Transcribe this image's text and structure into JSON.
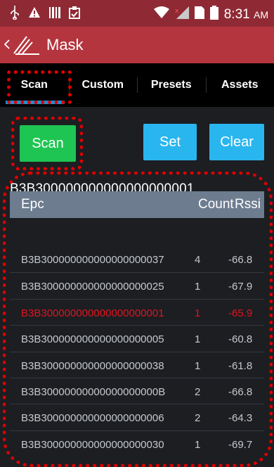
{
  "status_bar": {
    "time": "8:31",
    "ampm": "AM"
  },
  "app_bar": {
    "title": "Mask"
  },
  "tabs": [
    {
      "label": "Scan",
      "active": true
    },
    {
      "label": "Custom",
      "active": false
    },
    {
      "label": "Presets",
      "active": false
    },
    {
      "label": "Assets",
      "active": false
    }
  ],
  "buttons": {
    "scan": "Scan",
    "set": "Set",
    "clear": "Clear"
  },
  "selected_epc": "B3B300000000000000000001",
  "table": {
    "columns": {
      "epc": "Epc",
      "count": "Count",
      "rssi": "Rssi"
    },
    "rows": [
      {
        "epc": "B3B300000000000000000037",
        "count": "4",
        "rssi": "-66.8",
        "highlight": false
      },
      {
        "epc": "B3B300000000000000000025",
        "count": "1",
        "rssi": "-67.9",
        "highlight": false
      },
      {
        "epc": "B3B300000000000000000001",
        "count": "1",
        "rssi": "-65.9",
        "highlight": true
      },
      {
        "epc": "B3B300000000000000000005",
        "count": "1",
        "rssi": "-60.8",
        "highlight": false
      },
      {
        "epc": "B3B300000000000000000038",
        "count": "1",
        "rssi": "-61.8",
        "highlight": false
      },
      {
        "epc": "B3B30000000000000000000B",
        "count": "2",
        "rssi": "-66.8",
        "highlight": false
      },
      {
        "epc": "B3B300000000000000000006",
        "count": "2",
        "rssi": "-64.3",
        "highlight": false
      },
      {
        "epc": "B3B300000000000000000030",
        "count": "1",
        "rssi": "-69.7",
        "highlight": false
      }
    ]
  },
  "colors": {
    "status_bar": "#8f2a34",
    "app_bar": "#b5353f",
    "scan_button": "#1fc552",
    "action_button": "#29b6ee",
    "tab_indicator": "#1e8fd6",
    "highlight_text": "#e0141e",
    "annotation": "#e00000"
  },
  "icons": [
    "usb-icon",
    "warning-icon",
    "barcode-icon",
    "clipboard-icon",
    "wifi-icon",
    "signal-icon",
    "sim-icon",
    "battery-icon",
    "back-chevron-icon",
    "app-logo-icon"
  ]
}
